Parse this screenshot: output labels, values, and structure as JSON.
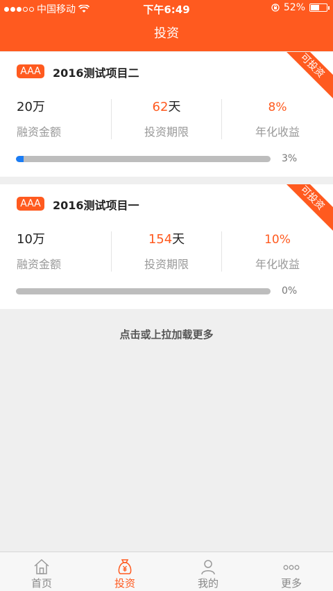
{
  "status": {
    "carrier": "中国移动",
    "time": "下午6:49",
    "battery": "52%"
  },
  "nav": {
    "title": "投资"
  },
  "projects": [
    {
      "badge": "AAA",
      "title": "2016测试项目二",
      "ribbon": "可投资",
      "amount": "20万",
      "amount_label": "融资金额",
      "period_num": "62",
      "period_unit": "天",
      "period_label": "投资期限",
      "rate": "8%",
      "rate_label": "年化收益",
      "progress": 3,
      "progress_text": "3%"
    },
    {
      "badge": "AAA",
      "title": "2016测试项目一",
      "ribbon": "可投资",
      "amount": "10万",
      "amount_label": "融资金额",
      "period_num": "154",
      "period_unit": "天",
      "period_label": "投资期限",
      "rate": "10%",
      "rate_label": "年化收益",
      "progress": 0,
      "progress_text": "0%"
    }
  ],
  "load_more": "点击或上拉加载更多",
  "tabs": [
    {
      "label": "首页",
      "icon": "home-icon"
    },
    {
      "label": "投资",
      "icon": "money-bag-icon"
    },
    {
      "label": "我的",
      "icon": "user-icon"
    },
    {
      "label": "更多",
      "icon": "more-icon"
    }
  ],
  "colors": {
    "accent": "#ff5a1f",
    "progress": "#1a7cf5"
  }
}
